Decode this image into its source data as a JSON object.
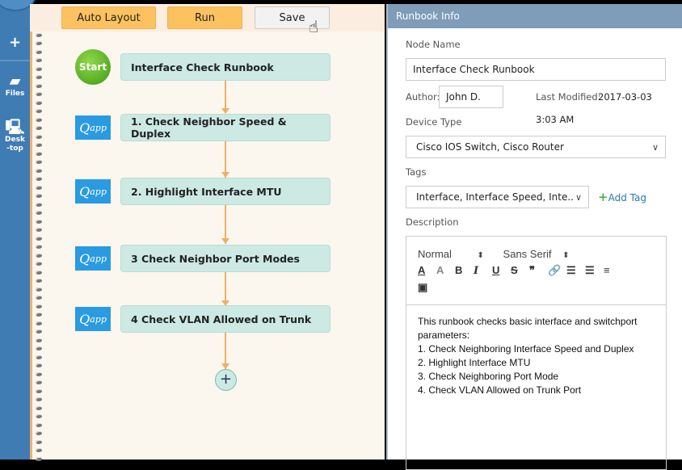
{
  "sidebar": {
    "items": [
      {
        "icon": "plus-icon",
        "label": ""
      },
      {
        "icon": "folder-icon",
        "label": "Files"
      },
      {
        "icon": "desktop-icon",
        "label": "Desk\n-top"
      }
    ]
  },
  "toolbar": {
    "auto_layout": "Auto Layout",
    "run": "Run",
    "save": "Save"
  },
  "flow": {
    "nodes": [
      {
        "badge": "Start",
        "label": "Interface Check Runbook"
      },
      {
        "badge": "Qapp",
        "label": "1. Check Neighbor Speed & Duplex"
      },
      {
        "badge": "Qapp",
        "label": "2. Highlight Interface MTU"
      },
      {
        "badge": "Qapp",
        "label": "3 Check Neighbor Port Modes"
      },
      {
        "badge": "Qapp",
        "label": "4 Check VLAN Allowed on Trunk"
      }
    ],
    "add": "+"
  },
  "panel": {
    "title": "Runbook Info",
    "node_name_label": "Node Name",
    "node_name": "Interface Check Runbook",
    "author_label": "Author:",
    "author": "John D.",
    "last_modified_label": "Last Modified:",
    "last_modified_date": "2017-03-03",
    "last_modified_time": "3:03 AM",
    "device_type_label": "Device Type",
    "device_type": "Cisco IOS Switch, Cisco Router",
    "tags_label": "Tags",
    "tags": "Interface, Interface Speed, Inte..",
    "add_tag": "Add Tag",
    "description_label": "Description",
    "editor": {
      "format": "Normal",
      "font": "Sans Serif",
      "lines": [
        "This runbook checks basic interface and switchport parameters:",
        "1. Check Neighboring Interface Speed and Duplex",
        "2. Highlight Interface MTU",
        "3. Check Neighboring Port Mode",
        "4. Check VLAN Allowed on Trunk Port"
      ]
    }
  },
  "colors": {
    "sidebar": "#3f7cb3",
    "node": "#cde9e4",
    "button": "#fbc25f",
    "header": "#7f9cb8",
    "connector": "#eeb060"
  }
}
